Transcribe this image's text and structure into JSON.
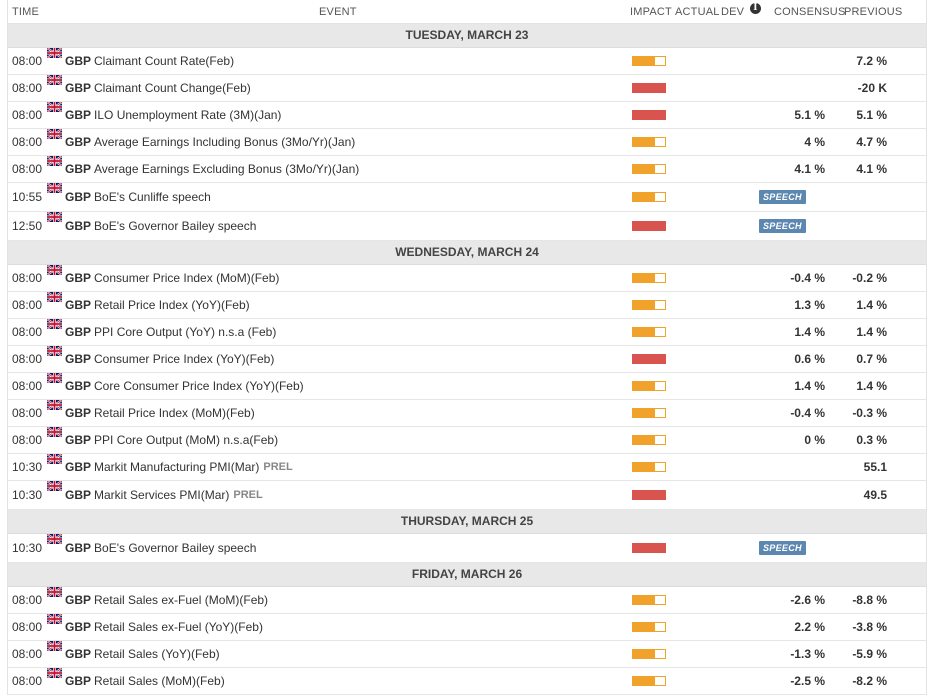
{
  "header": {
    "time": "TIME",
    "event": "EVENT",
    "impact": "IMPACT",
    "actual": "ACTUAL",
    "dev": "DEV",
    "consensus": "CONSENSUS",
    "previous": "PREVIOUS",
    "info_icon": "i"
  },
  "colors": {
    "impact_medium": "#f0a22a",
    "impact_high": "#d9534f",
    "speech_badge": "#5c87b0"
  },
  "days": [
    {
      "label": "TUESDAY, MARCH 23",
      "rows": [
        {
          "time": "08:00",
          "currency": "GBP",
          "event": "Claimant Count Rate(Feb)",
          "tag": "",
          "impact": "medium",
          "speech": "",
          "consensus": "",
          "previous": "7.2 %"
        },
        {
          "time": "08:00",
          "currency": "GBP",
          "event": "Claimant Count Change(Feb)",
          "tag": "",
          "impact": "high",
          "speech": "",
          "consensus": "",
          "previous": "-20 K"
        },
        {
          "time": "08:00",
          "currency": "GBP",
          "event": "ILO Unemployment Rate (3M)(Jan)",
          "tag": "",
          "impact": "high",
          "speech": "",
          "consensus": "5.1 %",
          "previous": "5.1 %"
        },
        {
          "time": "08:00",
          "currency": "GBP",
          "event": "Average Earnings Including Bonus (3Mo/Yr)(Jan)",
          "tag": "",
          "impact": "medium",
          "speech": "",
          "consensus": "4 %",
          "previous": "4.7 %"
        },
        {
          "time": "08:00",
          "currency": "GBP",
          "event": "Average Earnings Excluding Bonus (3Mo/Yr)(Jan)",
          "tag": "",
          "impact": "medium",
          "speech": "",
          "consensus": "4.1 %",
          "previous": "4.1 %"
        },
        {
          "time": "10:55",
          "currency": "GBP",
          "event": "BoE's Cunliffe speech",
          "tag": "",
          "impact": "medium",
          "speech": "SPEECH",
          "consensus": "",
          "previous": ""
        },
        {
          "time": "12:50",
          "currency": "GBP",
          "event": "BoE's Governor Bailey speech",
          "tag": "",
          "impact": "high",
          "speech": "SPEECH",
          "consensus": "",
          "previous": ""
        }
      ]
    },
    {
      "label": "WEDNESDAY, MARCH 24",
      "rows": [
        {
          "time": "08:00",
          "currency": "GBP",
          "event": "Consumer Price Index (MoM)(Feb)",
          "tag": "",
          "impact": "medium",
          "speech": "",
          "consensus": "-0.4 %",
          "previous": "-0.2 %"
        },
        {
          "time": "08:00",
          "currency": "GBP",
          "event": "Retail Price Index (YoY)(Feb)",
          "tag": "",
          "impact": "medium",
          "speech": "",
          "consensus": "1.3 %",
          "previous": "1.4 %"
        },
        {
          "time": "08:00",
          "currency": "GBP",
          "event": "PPI Core Output (YoY) n.s.a (Feb)",
          "tag": "",
          "impact": "medium",
          "speech": "",
          "consensus": "1.4 %",
          "previous": "1.4 %"
        },
        {
          "time": "08:00",
          "currency": "GBP",
          "event": "Consumer Price Index (YoY)(Feb)",
          "tag": "",
          "impact": "high",
          "speech": "",
          "consensus": "0.6 %",
          "previous": "0.7 %"
        },
        {
          "time": "08:00",
          "currency": "GBP",
          "event": "Core Consumer Price Index (YoY)(Feb)",
          "tag": "",
          "impact": "medium",
          "speech": "",
          "consensus": "1.4 %",
          "previous": "1.4 %"
        },
        {
          "time": "08:00",
          "currency": "GBP",
          "event": "Retail Price Index (MoM)(Feb)",
          "tag": "",
          "impact": "medium",
          "speech": "",
          "consensus": "-0.4 %",
          "previous": "-0.3 %"
        },
        {
          "time": "08:00",
          "currency": "GBP",
          "event": "PPI Core Output (MoM) n.s.a(Feb)",
          "tag": "",
          "impact": "medium",
          "speech": "",
          "consensus": "0 %",
          "previous": "0.3 %"
        },
        {
          "time": "10:30",
          "currency": "GBP",
          "event": "Markit Manufacturing PMI(Mar)",
          "tag": "PREL",
          "impact": "medium",
          "speech": "",
          "consensus": "",
          "previous": "55.1"
        },
        {
          "time": "10:30",
          "currency": "GBP",
          "event": "Markit Services PMI(Mar)",
          "tag": "PREL",
          "impact": "high",
          "speech": "",
          "consensus": "",
          "previous": "49.5"
        }
      ]
    },
    {
      "label": "THURSDAY, MARCH 25",
      "rows": [
        {
          "time": "10:30",
          "currency": "GBP",
          "event": "BoE's Governor Bailey speech",
          "tag": "",
          "impact": "high",
          "speech": "SPEECH",
          "consensus": "",
          "previous": ""
        }
      ]
    },
    {
      "label": "FRIDAY, MARCH 26",
      "rows": [
        {
          "time": "08:00",
          "currency": "GBP",
          "event": "Retail Sales ex-Fuel (MoM)(Feb)",
          "tag": "",
          "impact": "medium",
          "speech": "",
          "consensus": "-2.6 %",
          "previous": "-8.8 %"
        },
        {
          "time": "08:00",
          "currency": "GBP",
          "event": "Retail Sales ex-Fuel (YoY)(Feb)",
          "tag": "",
          "impact": "medium",
          "speech": "",
          "consensus": "2.2 %",
          "previous": "-3.8 %"
        },
        {
          "time": "08:00",
          "currency": "GBP",
          "event": "Retail Sales (YoY)(Feb)",
          "tag": "",
          "impact": "medium",
          "speech": "",
          "consensus": "-1.3 %",
          "previous": "-5.9 %"
        },
        {
          "time": "08:00",
          "currency": "GBP",
          "event": "Retail Sales (MoM)(Feb)",
          "tag": "",
          "impact": "medium",
          "speech": "",
          "consensus": "-2.5 %",
          "previous": "-8.2 %"
        }
      ]
    }
  ]
}
